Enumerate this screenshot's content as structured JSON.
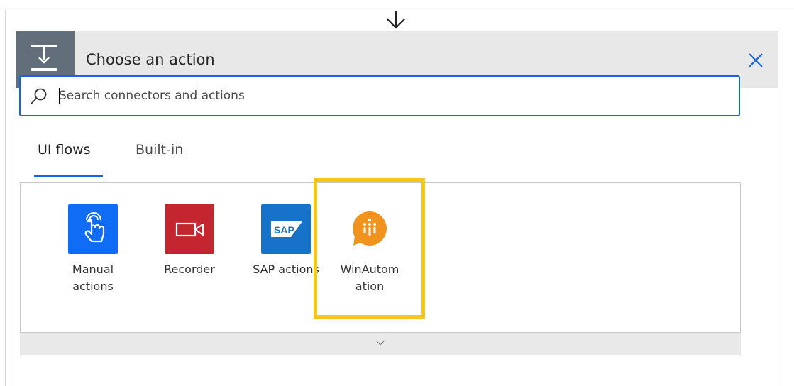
{
  "dialog": {
    "title": "Choose an action",
    "close_icon": "close-icon",
    "header_icon": "action-step-icon"
  },
  "search": {
    "value": "",
    "placeholder": "Search connectors and actions"
  },
  "tabs": [
    {
      "label": "UI flows",
      "selected": true
    },
    {
      "label": "Built-in",
      "selected": false
    }
  ],
  "connectors": [
    {
      "label": "Manual actions",
      "icon": "touch-hand-icon",
      "color": "#0f6cf4"
    },
    {
      "label": "Recorder",
      "icon": "video-camera-icon",
      "color": "#c3262f"
    },
    {
      "label": "SAP actions",
      "icon": "sap-logo-icon",
      "color": "#1673c9"
    },
    {
      "label": "WinAutomation",
      "icon": "winautomation-logo-icon",
      "color": "#f0931f"
    }
  ],
  "colors": {
    "accent": "#1465e6",
    "highlight": "#f7c61b",
    "header_bg": "#e8e8e8",
    "header_icon_bg": "#626f7a"
  }
}
